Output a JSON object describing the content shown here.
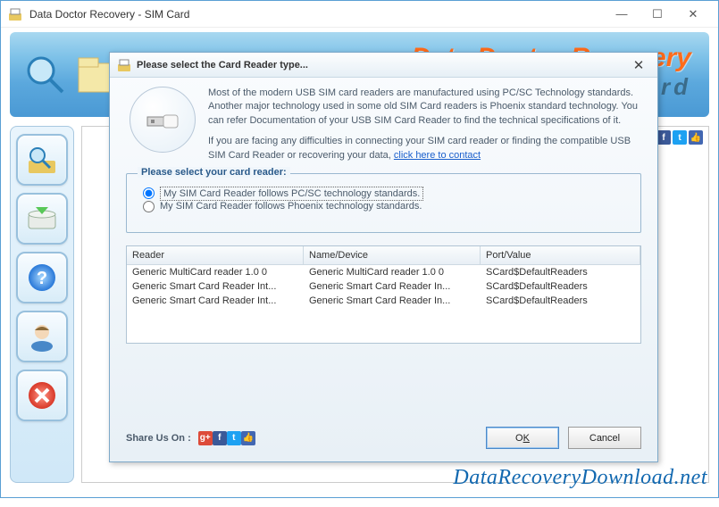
{
  "main_window": {
    "title": "Data Doctor Recovery - SIM Card"
  },
  "banner": {
    "brand_title": "Data Doctor Recovery",
    "brand_sub": "rd"
  },
  "social_icons": [
    "g+",
    "f",
    "t",
    "👍"
  ],
  "dialog": {
    "title": "Please select the Card Reader type...",
    "info_p1": "Most of the modern USB SIM card readers are manufactured using PC/SC Technology standards. Another major technology used in some old SIM Card readers is Phoenix standard technology. You can refer Documentation of your USB SIM Card Reader to find the technical specifications of it.",
    "info_p2_a": "If you are facing any difficulties in connecting your SIM card reader or finding the compatible USB SIM Card Reader or recovering your data, ",
    "info_link": " click here to contact ",
    "fieldset_legend": "Please select your card reader:",
    "radio1": "My SIM Card Reader follows PC/SC technology standards.",
    "radio2": "My SIM Card Reader follows Phoenix technology standards.",
    "grid": {
      "headers": {
        "reader": "Reader",
        "name": "Name/Device",
        "port": "Port/Value"
      },
      "rows": [
        {
          "reader": "Generic MultiCard reader 1.0 0",
          "name": "Generic MultiCard reader 1.0 0",
          "port": "SCard$DefaultReaders"
        },
        {
          "reader": "Generic Smart Card Reader Int...",
          "name": "Generic Smart Card Reader In...",
          "port": "SCard$DefaultReaders"
        },
        {
          "reader": "Generic Smart Card Reader Int...",
          "name": "Generic Smart Card Reader In...",
          "port": "SCard$DefaultReaders"
        }
      ]
    },
    "share_label": "Share Us On :",
    "ok_label_pre": "O",
    "ok_label_ul": "K",
    "cancel_label": "Cancel"
  },
  "watermark": "DataRecoveryDownload.net"
}
